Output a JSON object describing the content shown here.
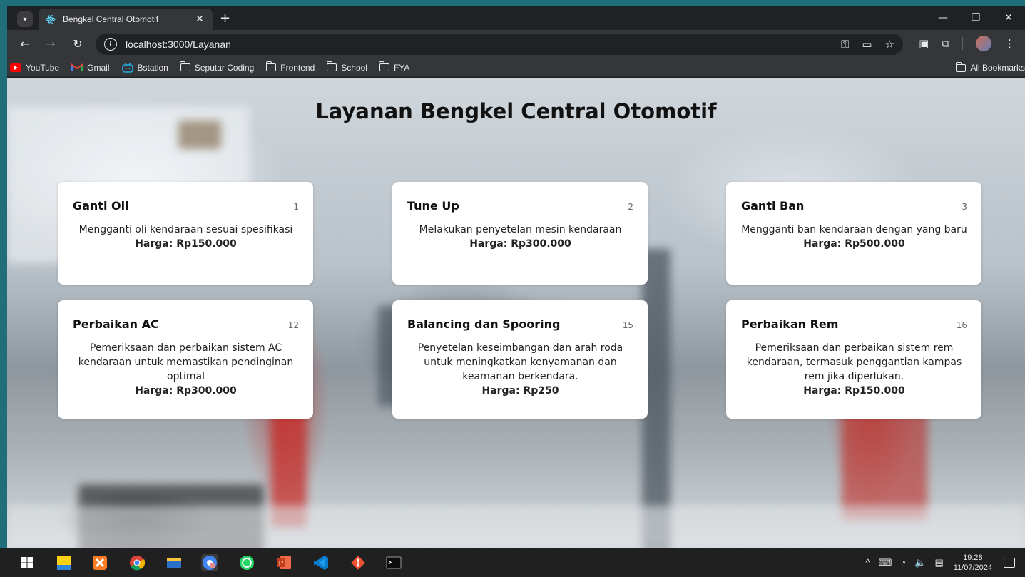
{
  "browser": {
    "tab_title": "Bengkel Central Otomotif",
    "url": "localhost:3000/Layanan",
    "bookmarks": [
      "YouTube",
      "Gmail",
      "Bstation",
      "Seputar Coding",
      "Frontend",
      "School",
      "FYA"
    ],
    "all_bookmarks_label": "All Bookmarks"
  },
  "page": {
    "title": "Layanan Bengkel Central Otomotif",
    "services": [
      {
        "id": "1",
        "name": "Ganti Oli",
        "description": "Mengganti oli kendaraan sesuai spesifikasi",
        "price": "Harga: Rp150.000"
      },
      {
        "id": "2",
        "name": "Tune Up",
        "description": "Melakukan penyetelan mesin kendaraan",
        "price": "Harga: Rp300.000"
      },
      {
        "id": "3",
        "name": "Ganti Ban",
        "description": "Mengganti ban kendaraan dengan yang baru",
        "price": "Harga: Rp500.000"
      },
      {
        "id": "12",
        "name": "Perbaikan AC",
        "description": "Pemeriksaan dan perbaikan sistem AC kendaraan untuk memastikan pendinginan optimal",
        "price": "Harga: Rp300.000"
      },
      {
        "id": "15",
        "name": "Balancing dan Spooring",
        "description": "Penyetelan keseimbangan dan arah roda untuk meningkatkan kenyamanan dan keamanan berkendara.",
        "price": "Harga: Rp250"
      },
      {
        "id": "16",
        "name": "Perbaikan Rem",
        "description": "Pemeriksaan dan perbaikan sistem rem kendaraan, termasuk penggantian kampas rem jika diperlukan.",
        "price": "Harga: Rp150.000"
      }
    ]
  },
  "taskbar": {
    "time": "19:28",
    "date": "11/07/2024"
  },
  "colors": {
    "desktop": "#1e6f7a",
    "browser_dark": "#202124",
    "browser_toolbar": "#35363a",
    "card": "#ffffff"
  }
}
